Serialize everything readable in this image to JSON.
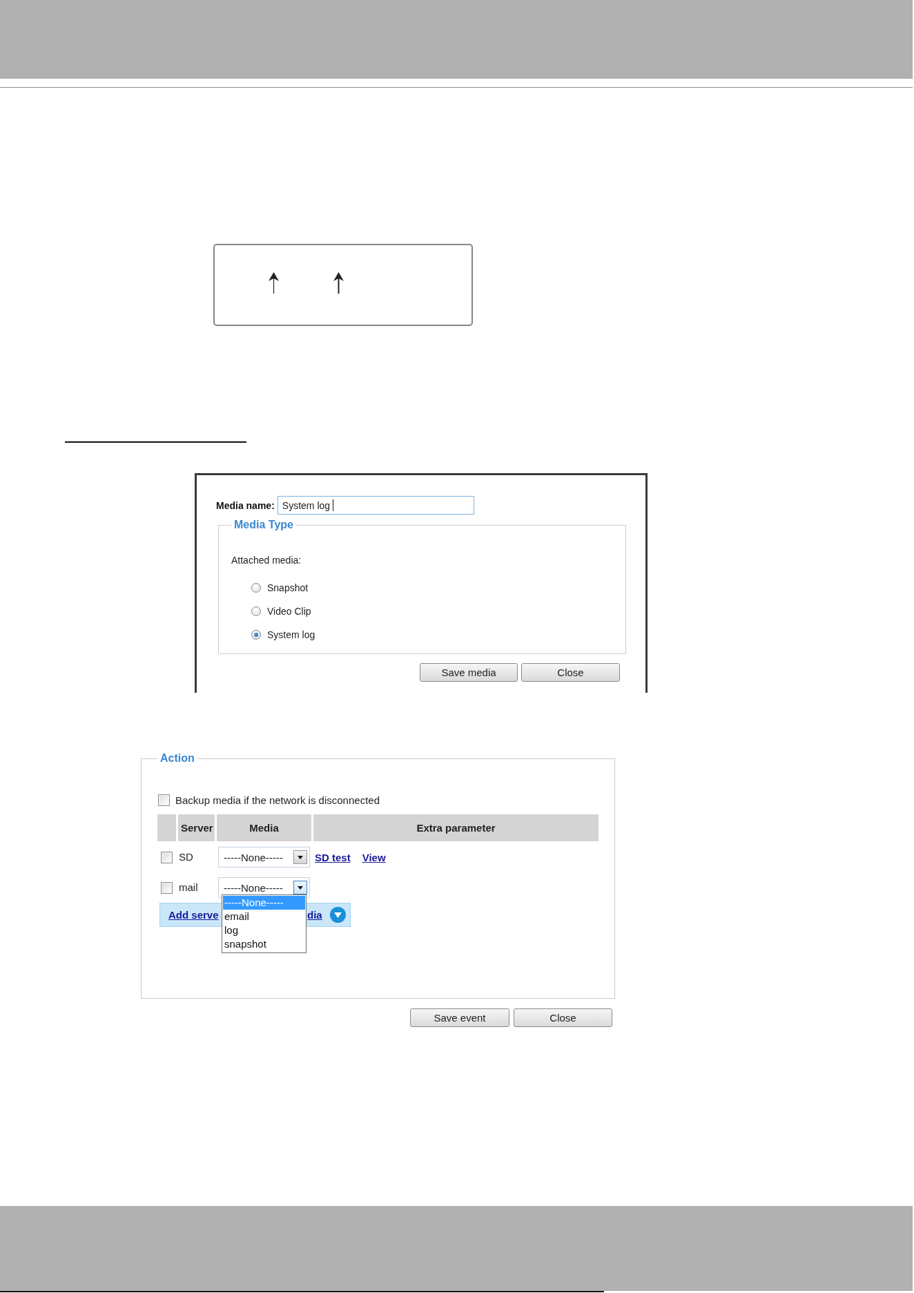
{
  "media_dialog": {
    "name_label": "Media name:",
    "name_value": "System log",
    "media_type": {
      "legend": "Media Type",
      "prompt": "Attached media:",
      "options": [
        {
          "label": "Snapshot",
          "selected": false
        },
        {
          "label": "Video Clip",
          "selected": false
        },
        {
          "label": "System log",
          "selected": true
        }
      ]
    },
    "buttons": [
      "Save media",
      "Close"
    ]
  },
  "action": {
    "legend": "Action",
    "backup": {
      "label": "Backup media if the network is disconnected",
      "checked": false
    },
    "table": {
      "columns": [
        "Server",
        "Media",
        "Extra parameter"
      ],
      "rows": [
        {
          "checked": false,
          "server": "SD",
          "media": "-----None-----",
          "expanded": false,
          "links": [
            "SD test",
            "View"
          ]
        },
        {
          "checked": false,
          "server": "mail",
          "media": "-----None-----",
          "expanded": true,
          "options": [
            {
              "label": "-----None-----",
              "selected": true
            },
            {
              "label": "email",
              "selected": false
            },
            {
              "label": "log",
              "selected": false
            },
            {
              "label": "snapshot",
              "selected": false
            }
          ]
        }
      ]
    },
    "add_link": {
      "visible_start": "Add serve",
      "visible_end": "dia"
    },
    "buttons": [
      "Save event",
      "Close"
    ]
  }
}
